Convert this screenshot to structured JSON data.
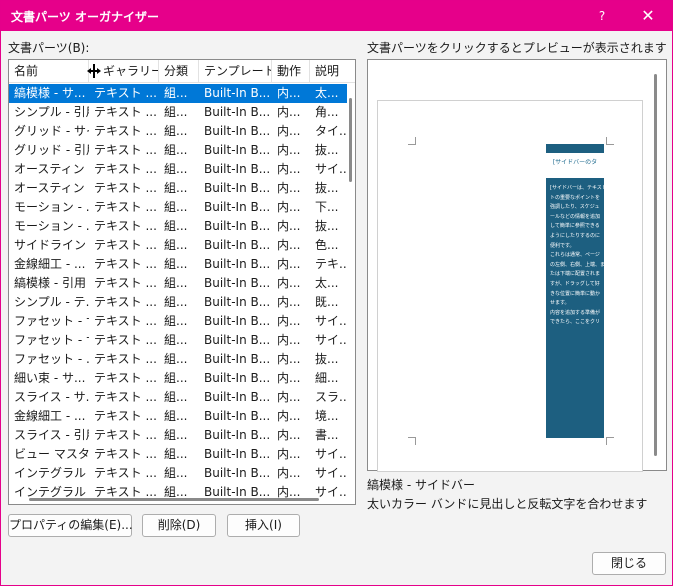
{
  "window": {
    "title": "文書パーツ オーガナイザー",
    "help_glyph": "?",
    "close_glyph": "✕",
    "accent_color": "#e6008a",
    "selection_color": "#0078d7"
  },
  "parts_label": "文書パーツ(B):",
  "preview_hint": "文書パーツをクリックするとプレビューが表示されます",
  "table": {
    "columns": [
      "名前",
      "ギャラリー",
      "分類",
      "テンプレート",
      "動作",
      "説明"
    ],
    "rows": [
      [
        "縞模様 - サ...",
        "テキスト ...",
        "組...",
        "Built-In B...",
        "内...",
        "太..."
      ],
      [
        "シンプル - 引用",
        "テキスト ...",
        "組...",
        "Built-In B...",
        "内...",
        "角..."
      ],
      [
        "グリッド - サイ...",
        "テキスト ...",
        "組...",
        "Built-In B...",
        "内...",
        "タイ..."
      ],
      [
        "グリッド - 引用",
        "テキスト ...",
        "組...",
        "Built-In B...",
        "内...",
        "抜..."
      ],
      [
        "オースティン - ...",
        "テキスト ...",
        "組...",
        "Built-In B...",
        "内...",
        "サイ..."
      ],
      [
        "オースティン - ...",
        "テキスト ...",
        "組...",
        "Built-In B...",
        "内...",
        "抜..."
      ],
      [
        "モーション - ...",
        "テキスト ...",
        "組...",
        "Built-In B...",
        "内...",
        "下..."
      ],
      [
        "モーション - ...",
        "テキスト ...",
        "組...",
        "Built-In B...",
        "内...",
        "抜..."
      ],
      [
        "サイドライン - ...",
        "テキスト ...",
        "組...",
        "Built-In B...",
        "内...",
        "色..."
      ],
      [
        "金線細工 - ...",
        "テキスト ...",
        "組...",
        "Built-In B...",
        "内...",
        "テキ..."
      ],
      [
        "縞模様 - 引用",
        "テキスト ...",
        "組...",
        "Built-In B...",
        "内...",
        "太..."
      ],
      [
        " シンプル - テ...",
        "テキスト ...",
        "組...",
        "Built-In B...",
        "内...",
        "既..."
      ],
      [
        "ファセット - サ...",
        "テキスト ...",
        "組...",
        "Built-In B...",
        "内...",
        "サイ..."
      ],
      [
        "ファセット - サ...",
        "テキスト ...",
        "組...",
        "Built-In B...",
        "内...",
        "サイ..."
      ],
      [
        "ファセット - ...",
        "テキスト ...",
        "組...",
        "Built-In B...",
        "内...",
        "抜..."
      ],
      [
        "細い束 - サ...",
        "テキスト ...",
        "組...",
        "Built-In B...",
        "内...",
        "細..."
      ],
      [
        "スライス - サ...",
        "テキスト ...",
        "組...",
        "Built-In B...",
        "内...",
        "スラ..."
      ],
      [
        "金線細工 - ...",
        "テキスト ...",
        "組...",
        "Built-In B...",
        "内...",
        "境..."
      ],
      [
        "スライス - 引用",
        "テキスト ...",
        "組...",
        "Built-In B...",
        "内...",
        "書..."
      ],
      [
        "ビュー マスター...",
        "テキスト ...",
        "組...",
        "Built-In B...",
        "内...",
        "サイ..."
      ],
      [
        "インテグラル - ...",
        "テキスト ...",
        "組...",
        "Built-In B...",
        "内...",
        "サイ..."
      ],
      [
        "インテグラル - ...",
        "テキスト ...",
        "組...",
        "Built-In B...",
        "内...",
        "サイ..."
      ]
    ],
    "selected_index": 0
  },
  "buttons": {
    "edit_properties": "プロパティの編集(E)...",
    "delete": "削除(D)",
    "insert": "挿入(I)",
    "close": "閉じる"
  },
  "preview": {
    "sidebar_heading": "[サイドバーのタ",
    "sidebar_lines": [
      "[サイドバーは、テキスト",
      "トの重要なポイントを",
      "強調したり、スケジュ",
      "ールなどの情報を追加",
      "して簡単に参照できる",
      "ようにしたりするのに",
      "便利です。",
      "これらは通常、ページ",
      "の左側、右側、上端、ま",
      "たは下端に配置されま",
      "すが、ドラッグして好",
      "きな位置に簡単に動か",
      "せます。",
      "内容を追加する準備が",
      "できたら、ここをクリ"
    ],
    "sidebar_color": "#1d5f80"
  },
  "selected_part": {
    "name": "縞模様 - サイドバー",
    "description": "太いカラー バンドに見出しと反転文字を合わせます"
  }
}
